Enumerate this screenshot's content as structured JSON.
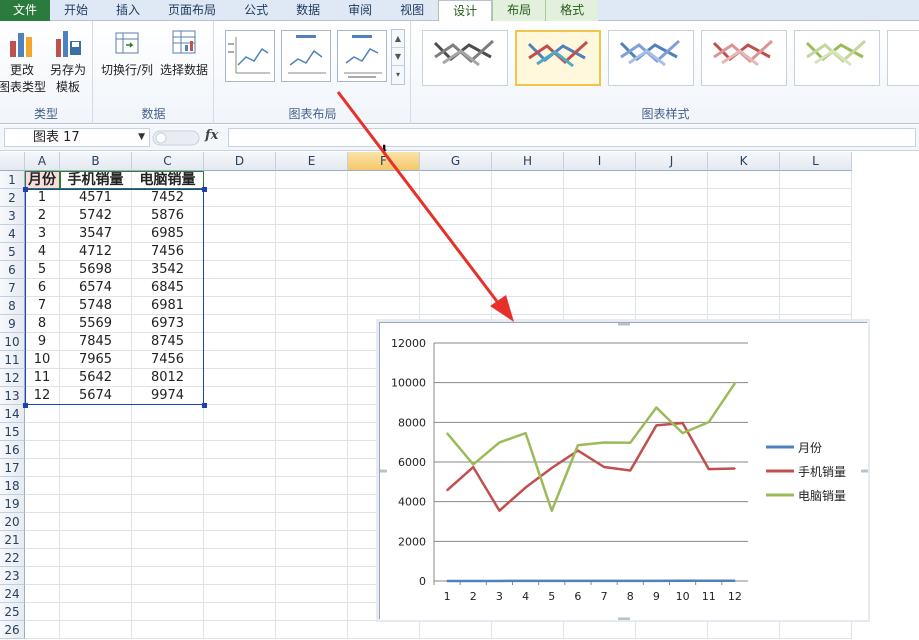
{
  "ribbon": {
    "tabs": [
      "文件",
      "开始",
      "插入",
      "页面布局",
      "公式",
      "数据",
      "审阅",
      "视图",
      "设计",
      "布局",
      "格式"
    ],
    "active_tab": "设计",
    "groups": {
      "type": {
        "label": "类型",
        "change_chart_type": "更改\n图表类型",
        "save_as_template": "另存为\n模板"
      },
      "data": {
        "label": "数据",
        "switch_row_col": "切换行/列",
        "select_data": "选择数据"
      },
      "chart_layout": {
        "label": "图表布局"
      },
      "chart_styles": {
        "label": "图表样式"
      }
    },
    "style_colors": [
      [
        "#4d4d4d",
        "#7f7f7f",
        "#a6a6a6"
      ],
      [
        "#4f81bd",
        "#c0504d",
        "#4bacc6"
      ],
      [
        "#4f81bd",
        "#7fa0d6",
        "#a9c0e6"
      ],
      [
        "#c0504d",
        "#d99694",
        "#e6b9b8"
      ],
      [
        "#9bbb59",
        "#c3d69b",
        "#d7e4bd"
      ]
    ]
  },
  "formula_bar": {
    "name_box": "图表 17",
    "fx_label": "fx",
    "formula": ""
  },
  "sheet": {
    "columns": [
      "A",
      "B",
      "C",
      "D",
      "E",
      "F",
      "G",
      "H",
      "I",
      "J",
      "K",
      "L"
    ],
    "selected_column": "F",
    "rows": [
      "1",
      "2",
      "3",
      "4",
      "5",
      "6",
      "7",
      "8",
      "9",
      "10",
      "11",
      "12",
      "13",
      "14",
      "15",
      "16",
      "17",
      "18",
      "19",
      "20",
      "21",
      "22",
      "23",
      "24",
      "25",
      "26"
    ],
    "headers": [
      "月份",
      "手机销量",
      "电脑销量"
    ],
    "data": [
      [
        "1",
        "4571",
        "7452"
      ],
      [
        "2",
        "5742",
        "5876"
      ],
      [
        "3",
        "3547",
        "6985"
      ],
      [
        "4",
        "4712",
        "7456"
      ],
      [
        "5",
        "5698",
        "3542"
      ],
      [
        "6",
        "6574",
        "6845"
      ],
      [
        "7",
        "5748",
        "6981"
      ],
      [
        "8",
        "5569",
        "6973"
      ],
      [
        "9",
        "7845",
        "8745"
      ],
      [
        "10",
        "7965",
        "7456"
      ],
      [
        "11",
        "5642",
        "8012"
      ],
      [
        "12",
        "5674",
        "9974"
      ]
    ]
  },
  "chart_data": {
    "type": "line",
    "title": "",
    "categories": [
      "1",
      "2",
      "3",
      "4",
      "5",
      "6",
      "7",
      "8",
      "9",
      "10",
      "11",
      "12"
    ],
    "series": [
      {
        "name": "月份",
        "color": "#4f81bd",
        "values": [
          1,
          2,
          3,
          4,
          5,
          6,
          7,
          8,
          9,
          10,
          11,
          12
        ]
      },
      {
        "name": "手机销量",
        "color": "#c0504d",
        "values": [
          4571,
          5742,
          3547,
          4712,
          5698,
          6574,
          5748,
          5569,
          7845,
          7965,
          5642,
          5674
        ]
      },
      {
        "name": "电脑销量",
        "color": "#9bbb59",
        "values": [
          7452,
          5876,
          6985,
          7456,
          3542,
          6845,
          6981,
          6973,
          8745,
          7456,
          8012,
          9974
        ]
      }
    ],
    "ylim": [
      0,
      12000
    ],
    "yticks": [
      0,
      2000,
      4000,
      6000,
      8000,
      10000,
      12000
    ],
    "grid": true,
    "legend": "right",
    "xlabel": "",
    "ylabel": ""
  },
  "annotation": {
    "arrow_color": "#e8302b"
  }
}
